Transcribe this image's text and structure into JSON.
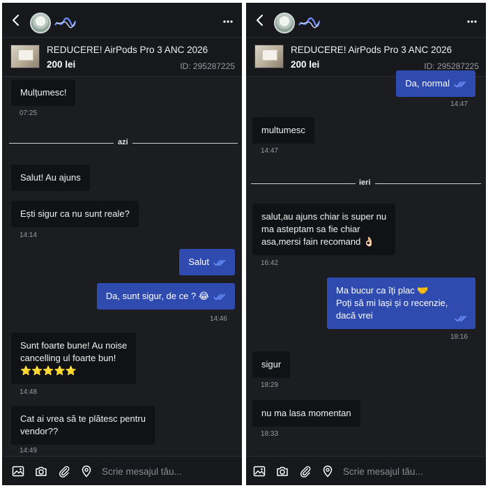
{
  "left": {
    "product": {
      "title": "REDUCERE! AirPods Pro 3 ANC 2026",
      "price": "200 lei",
      "id": "ID: 295287225"
    },
    "divider_label": "azi",
    "messages": [
      {
        "text": "Mulțumesc!",
        "time": "07:25"
      },
      {
        "text": "Salut! Au ajuns"
      },
      {
        "text": "Ești sigur ca nu sunt reale?",
        "time": "14:14"
      },
      {
        "text": "Salut"
      },
      {
        "text": "Da, sunt sigur, de ce ? 😂",
        "time": "14:46"
      },
      {
        "lines": [
          "Sunt foarte bune! Au noise",
          "cancelling ul foarte bun!",
          "⭐⭐⭐⭐⭐"
        ],
        "time": "14:48"
      },
      {
        "lines": [
          "Cat ai vrea să te plătesc pentru",
          "vendor??"
        ],
        "time": "14:49"
      }
    ],
    "composer_placeholder": "Scrie mesajul tău..."
  },
  "right": {
    "product": {
      "title": "REDUCERE! AirPods Pro 3 ANC 2026",
      "price": "200 lei",
      "id": "ID: 295287225"
    },
    "divider_label": "ieri",
    "messages": [
      {
        "text": "Da, normal",
        "time": "14:47"
      },
      {
        "text": "multumesc",
        "time": "14:47"
      },
      {
        "lines": [
          "salut,au ajuns chiar is super nu",
          "ma asteptam sa fie chiar",
          "asa,mersi fain recomand 👌🏻"
        ],
        "time": "16:42"
      },
      {
        "lines": [
          "Ma bucur ca îți plac 🤝",
          "Poți să mi lași și o recenzie,",
          "dacă vrei"
        ],
        "time": "18:16"
      },
      {
        "text": "sigur",
        "time": "18:29"
      },
      {
        "text": "nu ma lasa momentan",
        "time": "18:33"
      }
    ],
    "composer_placeholder": "Scrie mesajul tău..."
  },
  "colors": {
    "background": "#1c1d21",
    "outgoing_bubble": "#2f4bb0",
    "incoming_bubble": "#111215",
    "read_ticks": "#6f95ff"
  },
  "icons": [
    "back-arrow",
    "avatar",
    "more-dots",
    "image",
    "camera",
    "paperclip",
    "location-pin",
    "double-check"
  ]
}
